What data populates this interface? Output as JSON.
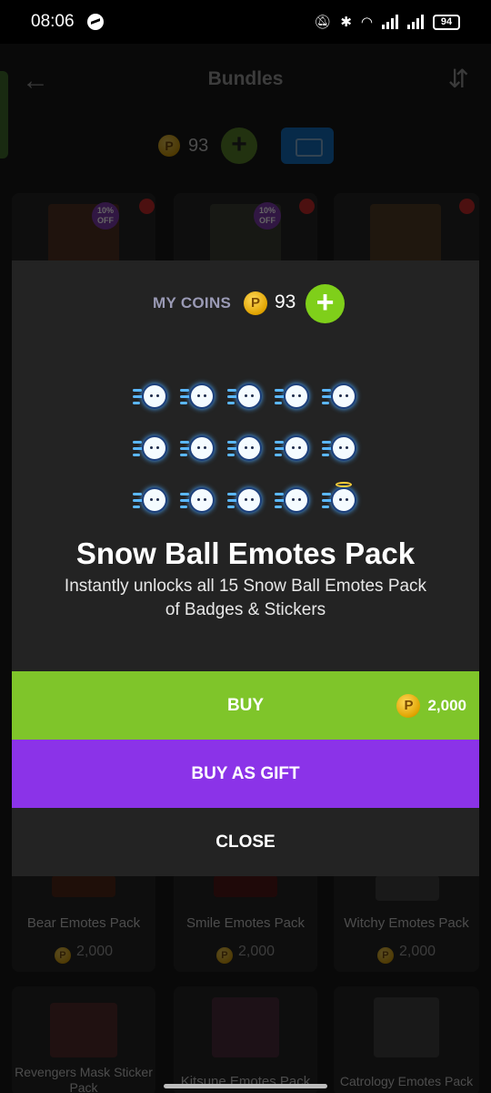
{
  "status_bar": {
    "time": "08:06",
    "battery": "94"
  },
  "app_bar": {
    "title": "Bundles"
  },
  "coins_row": {
    "balance": "93",
    "coin_glyph": "P"
  },
  "bg_cards": [
    {
      "badge": "10% OFF"
    },
    {
      "badge": "10% OFF"
    },
    {
      "badge": ""
    },
    {
      "title": "Bear Emotes Pack",
      "price": "2,000"
    },
    {
      "title": "Smile Emotes Pack",
      "price": "2,000"
    },
    {
      "title": "Witchy Emotes Pack",
      "price": "2,000"
    },
    {
      "title": "Revengers Mask Sticker Pack"
    },
    {
      "title": "Kitsune Emotes Pack"
    },
    {
      "title": "Catrology Emotes Pack"
    }
  ],
  "modal": {
    "my_coins_label": "MY COINS",
    "my_coins_value": "93",
    "title": "Snow Ball Emotes Pack",
    "description": "Instantly unlocks all 15 Snow Ball Emotes Pack of Badges & Stickers",
    "buy_label": "BUY",
    "buy_price": "2,000",
    "gift_label": "BUY AS GIFT",
    "close_label": "CLOSE"
  },
  "colors": {
    "buy": "#7fc52a",
    "gift": "#8b33e8",
    "plus": "#7fcf1a",
    "modal_bg": "#232323"
  }
}
